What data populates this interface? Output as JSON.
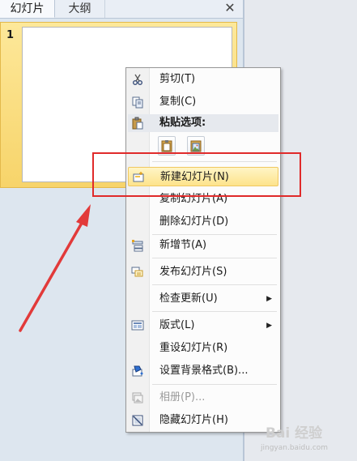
{
  "pane": {
    "tabs": [
      {
        "label": "幻灯片",
        "active": true
      },
      {
        "label": "大纲",
        "active": false
      }
    ],
    "close_glyph": "✕"
  },
  "slides": [
    {
      "number": "1",
      "selected": true
    }
  ],
  "context_menu": {
    "items": [
      {
        "label": "剪切(T)",
        "icon": "scissors-icon"
      },
      {
        "label": "复制(C)",
        "icon": "copy-icon"
      },
      {
        "label": "粘贴选项:",
        "icon": "clipboard-icon",
        "header": true
      },
      {
        "label": "新建幻灯片(N)",
        "icon": "new-slide-icon",
        "highlighted": true
      },
      {
        "label": "复制幻灯片(A)",
        "icon": ""
      },
      {
        "label": "删除幻灯片(D)",
        "icon": ""
      },
      {
        "label": "新增节(A)",
        "icon": "add-section-icon"
      },
      {
        "label": "发布幻灯片(S)",
        "icon": "publish-slides-icon"
      },
      {
        "label": "检查更新(U)",
        "icon": "",
        "submenu": true
      },
      {
        "label": "版式(L)",
        "icon": "layout-icon",
        "submenu": true
      },
      {
        "label": "重设幻灯片(R)",
        "icon": ""
      },
      {
        "label": "设置背景格式(B)...",
        "icon": "format-background-icon"
      },
      {
        "label": "相册(P)...",
        "icon": "photo-album-icon",
        "disabled": true
      },
      {
        "label": "隐藏幻灯片(H)",
        "icon": "hide-slide-icon"
      }
    ],
    "paste_options": [
      {
        "icon": "paste-use-destination-theme-icon"
      },
      {
        "icon": "paste-as-picture-icon"
      }
    ]
  },
  "colors": {
    "highlight": "#fde38b",
    "annotation_red": "#e02a2a"
  },
  "watermark": {
    "main": "Bai 经验",
    "sub": "jingyan.baidu.com"
  }
}
